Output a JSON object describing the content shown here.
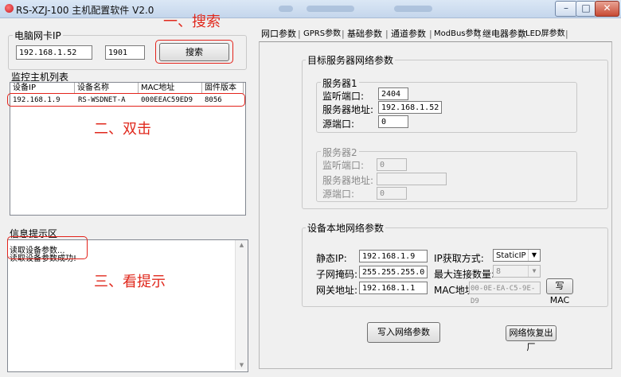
{
  "window": {
    "title": "RS-XZJ-100 主机配置软件 V2.0",
    "min": "–",
    "max": "□",
    "close": "✕"
  },
  "left": {
    "pc_nic": {
      "legend": "电脑网卡IP",
      "ip": "192.168.1.52",
      "port": "1901",
      "search_button": "搜索"
    },
    "host_list": {
      "label": "监控主机列表",
      "columns": [
        "设备IP",
        "设备名称",
        "MAC地址",
        "固件版本"
      ],
      "rows": [
        [
          "192.168.1.9",
          "RS-WSDNET-A",
          "000EEAC59ED9",
          "8056"
        ]
      ]
    },
    "info": {
      "label": "信息提示区",
      "lines": [
        "读取设备参数...",
        "读取设备参数成功!"
      ]
    }
  },
  "annotations": {
    "step1": "一、搜索",
    "step2": "二、双击",
    "step3": "三、看提示"
  },
  "tabs": [
    "网口参数",
    "GPRS参数",
    "基础参数",
    "通道参数",
    "ModBus参数",
    "继电器参数",
    "LED屏参数"
  ],
  "target_server": {
    "legend": "目标服务器网络参数",
    "server1": {
      "legend": "服务器1",
      "listen_port_label": "监听端口:",
      "listen_port": "2404",
      "address_label": "服务器地址:",
      "address": "192.168.1.52",
      "src_port_label": "源端口:",
      "src_port": "0"
    },
    "server2": {
      "legend": "服务器2",
      "listen_port_label": "监听端口:",
      "listen_port": "0",
      "address_label": "服务器地址:",
      "address": "",
      "src_port_label": "源端口:",
      "src_port": "0"
    }
  },
  "local_net": {
    "legend": "设备本地网络参数",
    "static_ip_label": "静态IP:",
    "static_ip": "192.168.1.9",
    "ip_mode_label": "IP获取方式:",
    "ip_mode": "StaticIP",
    "mask_label": "子网掩码:",
    "mask": "255.255.255.0",
    "max_conn_label": "最大连接数量:",
    "max_conn": "8",
    "gateway_label": "网关地址:",
    "gateway": "192.168.1.1",
    "mac_label": "MAC地址:",
    "mac": "00-0E-EA-C5-9E-D9",
    "write_mac_button": "写MAC"
  },
  "actions": {
    "write_net_button": "写入网络参数",
    "restore_button": "网络恢复出厂"
  }
}
